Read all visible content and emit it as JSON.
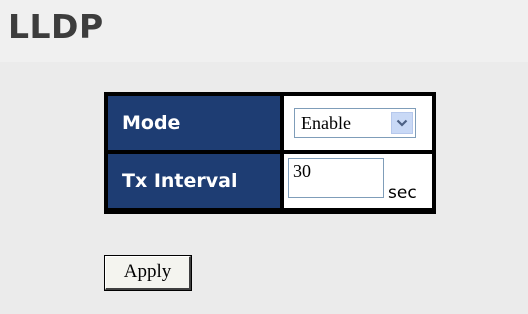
{
  "page": {
    "title": "LLDP"
  },
  "settings": {
    "mode": {
      "label": "Mode",
      "value": "Enable",
      "dropdown_icon": "chevron-down-icon"
    },
    "tx_interval": {
      "label": "Tx Interval",
      "value": "30",
      "unit": "sec"
    }
  },
  "actions": {
    "apply_label": "Apply"
  },
  "colors": {
    "background": "#ebebeb",
    "label_cell": "#1e3d73",
    "label_text": "#ffffff",
    "table_border": "#000000",
    "dropdown_button": "#c9d9f6"
  }
}
